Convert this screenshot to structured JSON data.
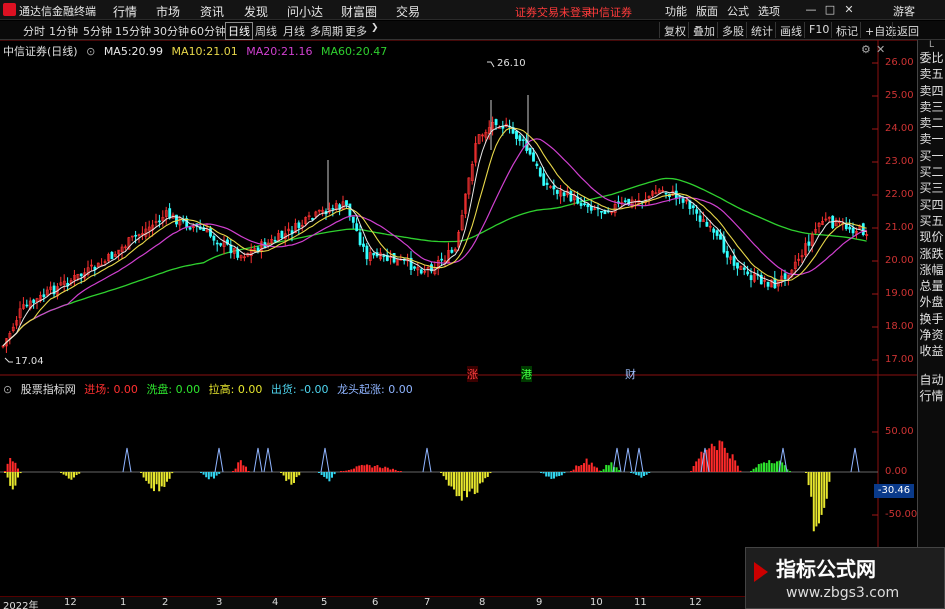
{
  "app": {
    "title": "通达信金融终端",
    "menu": [
      "行情",
      "市场",
      "资讯",
      "发现",
      "问小达",
      "财富圈",
      "交易"
    ],
    "notice": "证券交易未登录",
    "broker": "中信证券",
    "right_menu": [
      "功能",
      "版面",
      "公式",
      "选项"
    ],
    "guest": "游客",
    "window_buttons": [
      "—",
      "□",
      "✕"
    ]
  },
  "periodbar": {
    "periods": [
      "分时",
      "1分钟",
      "5分钟",
      "15分钟",
      "30分钟",
      "60分钟",
      "日线",
      "周线",
      "月线",
      "多周期",
      "更多"
    ],
    "active_period": "日线",
    "tools": [
      "复权",
      "叠加",
      "多股",
      "统计",
      "画线",
      "F10",
      "标记",
      "+自选",
      "返回"
    ]
  },
  "main_chart": {
    "stock_label": "中信证券(日线)",
    "ma": [
      {
        "label": "MA5:",
        "value": "20.99",
        "color": "#e8e8e8"
      },
      {
        "label": "MA10:",
        "value": "21.01",
        "color": "#e8d84a"
      },
      {
        "label": "MA20:",
        "value": "21.16",
        "color": "#d040d0"
      },
      {
        "label": "MA60:",
        "value": "20.47",
        "color": "#2fd02f"
      }
    ],
    "high_label": "26.10",
    "low_label": "17.04",
    "yticks": [
      "26.00",
      "25.00",
      "24.00",
      "23.00",
      "22.00",
      "21.00",
      "20.00",
      "19.00",
      "18.00",
      "17.00"
    ],
    "event_marks": [
      {
        "text": "涨",
        "color": "#ff4040"
      },
      {
        "text": "港",
        "color": "#40ff40"
      },
      {
        "text": "财",
        "color": "#a0c0ff"
      }
    ]
  },
  "sub_chart": {
    "name": "股票指标网",
    "indicators": [
      {
        "label": "进场:",
        "value": "0.00",
        "color": "#ff3030"
      },
      {
        "label": "洗盘:",
        "value": "0.00",
        "color": "#2ee62e"
      },
      {
        "label": "拉高:",
        "value": "0.00",
        "color": "#e6e62e"
      },
      {
        "label": "出货:",
        "value": "-0.00",
        "color": "#4fd6f0"
      },
      {
        "label": "龙头起涨:",
        "value": "0.00",
        "color": "#8fb4ff"
      }
    ],
    "yticks": [
      "50.00",
      "0.00",
      "-50.00"
    ],
    "current_value": "-30.46"
  },
  "sidebar": [
    "委比",
    "卖五",
    "卖四",
    "卖三",
    "卖二",
    "卖一",
    "买一",
    "买二",
    "买三",
    "买四",
    "买五",
    "现价",
    "涨跌",
    "涨幅",
    "总量",
    "外盘",
    "换手",
    "净资",
    "收益"
  ],
  "sidebar_bottom": [
    "自动",
    "行情"
  ],
  "date_axis": [
    "2022年",
    "12",
    "1",
    "2",
    "3",
    "4",
    "5",
    "6",
    "7",
    "8",
    "9",
    "10",
    "11",
    "12"
  ],
  "watermark": {
    "line1": "指标公式网",
    "line2": "www.zbgs3.com"
  },
  "colors": {
    "up": "#ff3232",
    "down": "#33ffff",
    "ma5": "#e8e8e8",
    "ma10": "#e8d84a",
    "ma20": "#d040d0",
    "ma60": "#2fd02f",
    "axis": "#d03030"
  }
}
